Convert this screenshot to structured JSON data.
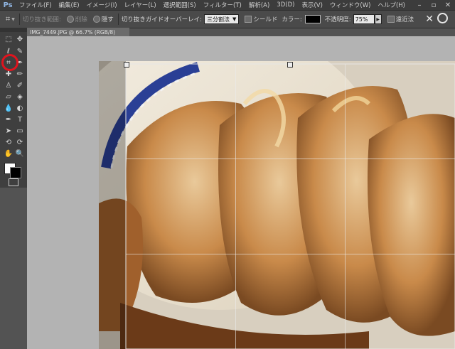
{
  "app": {
    "logo": "Ps"
  },
  "menu": [
    "ファイル(F)",
    "編集(E)",
    "イメージ(I)",
    "レイヤー(L)",
    "選択範囲(S)",
    "フィルター(T)",
    "解析(A)",
    "3D(D)",
    "表示(V)",
    "ウィンドウ(W)",
    "ヘルプ(H)"
  ],
  "options": {
    "crop_area_label": "切り抜き範囲:",
    "delete_label": "削除",
    "hide_label": "隠す",
    "overlay_label": "切り抜きガイドオーバーレイ:",
    "overlay_value": "三分割法",
    "shield_label": "シールド",
    "color_label": "カラー:",
    "opacity_label": "不透明度:",
    "opacity_value": "75%",
    "perspective_label": "遠近法",
    "shield_color": "#000000"
  },
  "document": {
    "tab_title": "IMG_7449.JPG @ 66.7% (RGB/8)"
  },
  "highlight": {
    "color": "#e0141e",
    "target": "crop-tool"
  }
}
